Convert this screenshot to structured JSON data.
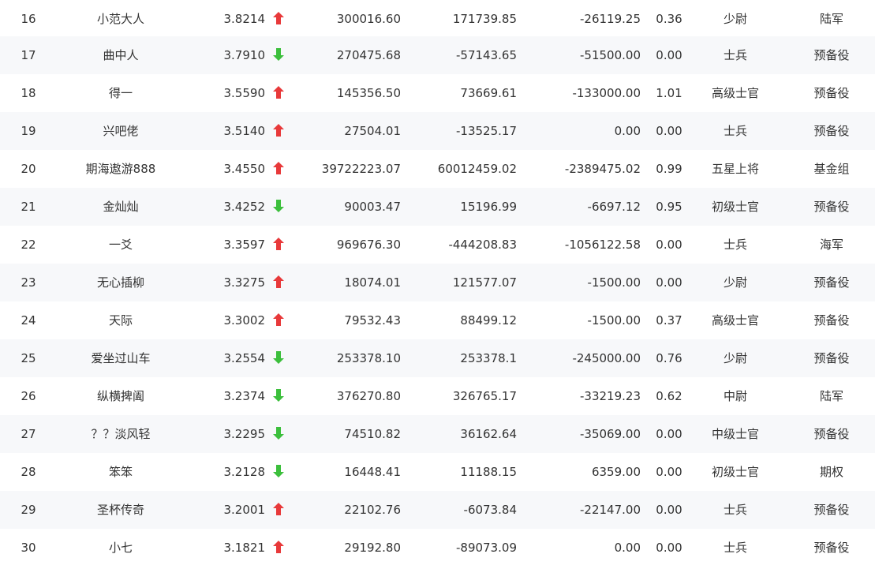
{
  "colors": {
    "up_arrow": "#e8393a",
    "down_arrow": "#3cbf3c",
    "row_alt_bg": "#f7f8fa",
    "text": "#333333"
  },
  "rows": [
    {
      "rank": "16",
      "name": "小范大人",
      "score": "3.8214",
      "trend": "up",
      "a": "300016.60",
      "b": "171739.85",
      "c": "-26119.25",
      "d": "0.36",
      "title": "少尉",
      "group": "陆军"
    },
    {
      "rank": "17",
      "name": "曲中人",
      "score": "3.7910",
      "trend": "down",
      "a": "270475.68",
      "b": "-57143.65",
      "c": "-51500.00",
      "d": "0.00",
      "title": "士兵",
      "group": "预备役"
    },
    {
      "rank": "18",
      "name": "得一",
      "score": "3.5590",
      "trend": "up",
      "a": "145356.50",
      "b": "73669.61",
      "c": "-133000.00",
      "d": "1.01",
      "title": "高级士官",
      "group": "预备役"
    },
    {
      "rank": "19",
      "name": "兴吧佬",
      "score": "3.5140",
      "trend": "up",
      "a": "27504.01",
      "b": "-13525.17",
      "c": "0.00",
      "d": "0.00",
      "title": "士兵",
      "group": "预备役"
    },
    {
      "rank": "20",
      "name": "期海遨游888",
      "score": "3.4550",
      "trend": "up",
      "a": "39722223.07",
      "b": "60012459.02",
      "c": "-2389475.02",
      "d": "0.99",
      "title": "五星上将",
      "group": "基金组"
    },
    {
      "rank": "21",
      "name": "金灿灿",
      "score": "3.4252",
      "trend": "down",
      "a": "90003.47",
      "b": "15196.99",
      "c": "-6697.12",
      "d": "0.95",
      "title": "初级士官",
      "group": "预备役"
    },
    {
      "rank": "22",
      "name": "一爻",
      "score": "3.3597",
      "trend": "up",
      "a": "969676.30",
      "b": "-444208.83",
      "c": "-1056122.58",
      "d": "0.00",
      "title": "士兵",
      "group": "海军"
    },
    {
      "rank": "23",
      "name": "无心插柳",
      "score": "3.3275",
      "trend": "up",
      "a": "18074.01",
      "b": "121577.07",
      "c": "-1500.00",
      "d": "0.00",
      "title": "少尉",
      "group": "预备役"
    },
    {
      "rank": "24",
      "name": "天际",
      "score": "3.3002",
      "trend": "up",
      "a": "79532.43",
      "b": "88499.12",
      "c": "-1500.00",
      "d": "0.37",
      "title": "高级士官",
      "group": "预备役"
    },
    {
      "rank": "25",
      "name": "爱坐过山车",
      "score": "3.2554",
      "trend": "down",
      "a": "253378.10",
      "b": "253378.1",
      "c": "-245000.00",
      "d": "0.76",
      "title": "少尉",
      "group": "预备役"
    },
    {
      "rank": "26",
      "name": "纵横捭阖",
      "score": "3.2374",
      "trend": "down",
      "a": "376270.80",
      "b": "326765.17",
      "c": "-33219.23",
      "d": "0.62",
      "title": "中尉",
      "group": "陆军"
    },
    {
      "rank": "27",
      "name": "？？淡风轻",
      "score": "3.2295",
      "trend": "down",
      "a": "74510.82",
      "b": "36162.64",
      "c": "-35069.00",
      "d": "0.00",
      "title": "中级士官",
      "group": "预备役"
    },
    {
      "rank": "28",
      "name": "笨笨",
      "score": "3.2128",
      "trend": "down",
      "a": "16448.41",
      "b": "11188.15",
      "c": "6359.00",
      "d": "0.00",
      "title": "初级士官",
      "group": "期权"
    },
    {
      "rank": "29",
      "name": "圣杯传奇",
      "score": "3.2001",
      "trend": "up",
      "a": "22102.76",
      "b": "-6073.84",
      "c": "-22147.00",
      "d": "0.00",
      "title": "士兵",
      "group": "预备役"
    },
    {
      "rank": "30",
      "name": "小七",
      "score": "3.1821",
      "trend": "up",
      "a": "29192.80",
      "b": "-89073.09",
      "c": "0.00",
      "d": "0.00",
      "title": "士兵",
      "group": "预备役"
    }
  ]
}
